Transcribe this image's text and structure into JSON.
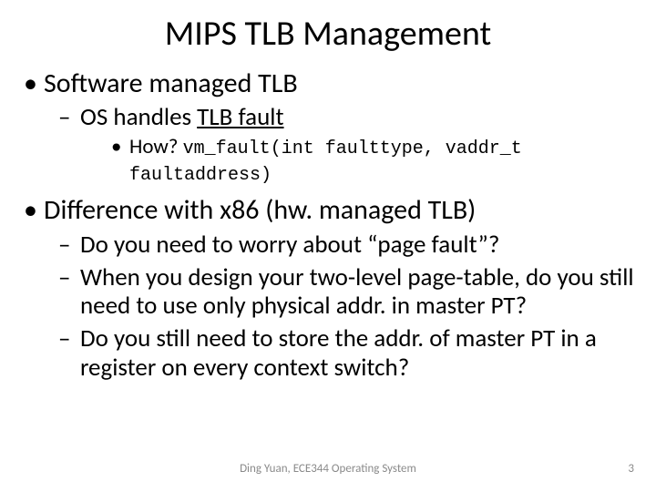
{
  "title": "MIPS TLB Management",
  "bullets": {
    "b1": "Software managed TLB",
    "b1_1_pre": "OS handles ",
    "b1_1_ul": "TLB fault",
    "b1_1_1_pre": "How? ",
    "b1_1_1_code": "vm_fault(int faulttype, vaddr_t faultaddress)",
    "b2": "Difference with x86 (hw. managed TLB)",
    "b2_1": "Do you need to worry about “page fault”?",
    "b2_2": "When you design your two-level page-table, do you still need to use only physical addr. in master PT?",
    "b2_3": "Do you still need to store the addr. of master PT in a register on every context switch?"
  },
  "footer": {
    "center": "Ding Yuan, ECE344 Operating System",
    "page": "3"
  }
}
